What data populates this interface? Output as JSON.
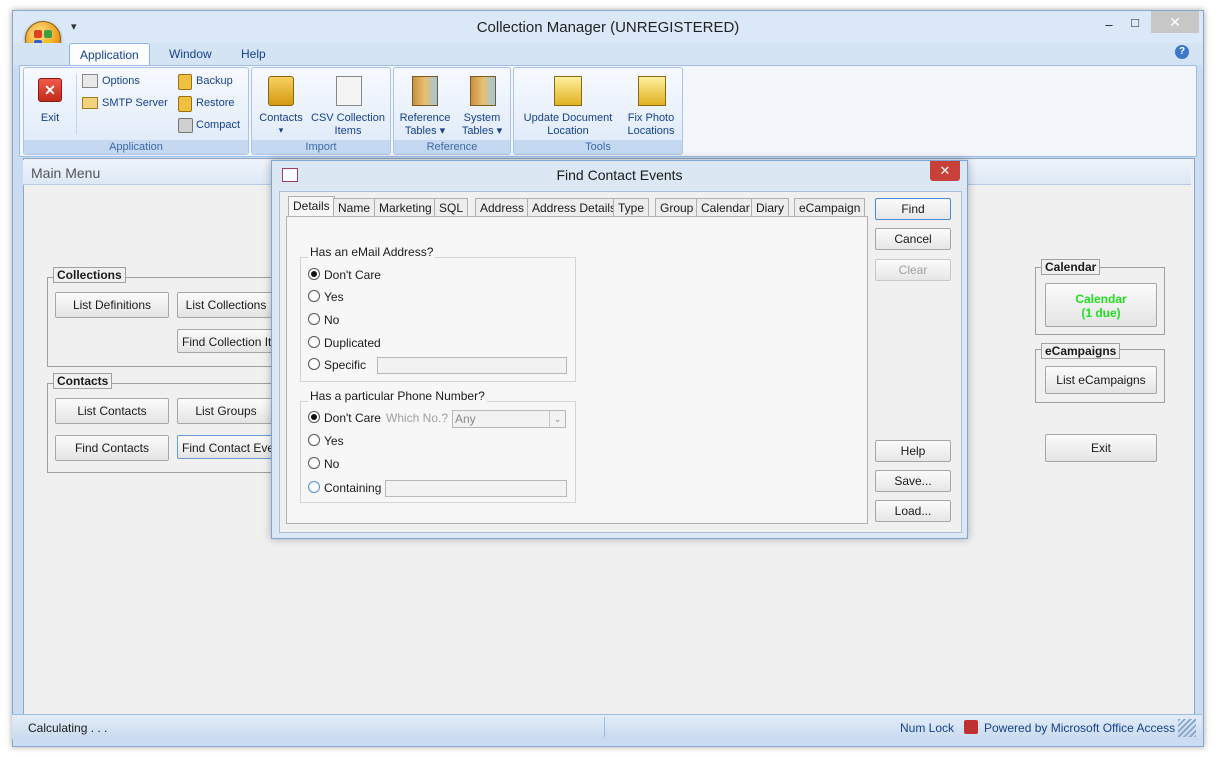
{
  "window": {
    "title": "Collection Manager (UNREGISTERED)",
    "qat_glyph": "▾",
    "minimize": "–",
    "maximize": "□",
    "close": "✕",
    "help": "?"
  },
  "ribbon": {
    "tabs": [
      {
        "label": "Application",
        "active": true
      },
      {
        "label": "Window"
      },
      {
        "label": "Help"
      }
    ],
    "groups": {
      "application": {
        "label": "Application",
        "exit": "Exit",
        "options": "Options",
        "smtp": "SMTP Server",
        "backup": "Backup",
        "restore": "Restore",
        "compact": "Compact"
      },
      "import": {
        "label": "Import",
        "contacts": "Contacts",
        "contacts_arrow": "▾",
        "csv_line1": "CSV Collection",
        "csv_line2": "Items"
      },
      "reference": {
        "label": "Reference",
        "ref_line1": "Reference",
        "ref_line2": "Tables ▾",
        "sys_line1": "System",
        "sys_line2": "Tables ▾"
      },
      "tools": {
        "label": "Tools",
        "upd_line1": "Update Document",
        "upd_line2": "Location",
        "fix_line1": "Fix Photo",
        "fix_line2": "Locations"
      }
    }
  },
  "main_menu": {
    "title": "Main Menu",
    "collections": {
      "legend": "Collections",
      "list_definitions": "List Definitions",
      "list_collections": "List Collections",
      "find_collection_items": "Find Collection Iter"
    },
    "contacts": {
      "legend": "Contacts",
      "list_contacts": "List Contacts",
      "list_groups": "List Groups",
      "find_contacts": "Find Contacts",
      "find_contact_events": "Find Contact Even"
    },
    "calendar": {
      "legend": "Calendar",
      "button_line1": "Calendar",
      "button_line2": "(1 due)",
      "due_color": "#22dd22"
    },
    "ecampaigns": {
      "legend": "eCampaigns",
      "list_ecampaigns": "List eCampaigns"
    },
    "exit": "Exit"
  },
  "dialog": {
    "title": "Find Contact Events",
    "close": "✕",
    "tabs": [
      "Details",
      "Name",
      "Marketing",
      "SQL",
      "Address",
      "Address Details",
      "Type",
      "Group",
      "Calendar",
      "Diary",
      "eCampaign"
    ],
    "active_tab": "Details",
    "email_group": {
      "title": "Has an eMail Address?",
      "options": [
        "Don't Care",
        "Yes",
        "No",
        "Duplicated",
        "Specific"
      ],
      "selected": "Don't Care"
    },
    "phone_group": {
      "title": "Has a particular Phone Number?",
      "options": [
        "Don't Care",
        "Yes",
        "No",
        "Containing"
      ],
      "selected": "Don't Care",
      "which_label": "Which No.?",
      "which_value": "Any"
    },
    "buttons": {
      "find": "Find",
      "cancel": "Cancel",
      "clear": "Clear",
      "help": "Help",
      "save": "Save...",
      "load": "Load..."
    }
  },
  "statusbar": {
    "left": "Calculating . . .",
    "numlock": "Num Lock",
    "powered": "Powered by Microsoft Office Access"
  }
}
